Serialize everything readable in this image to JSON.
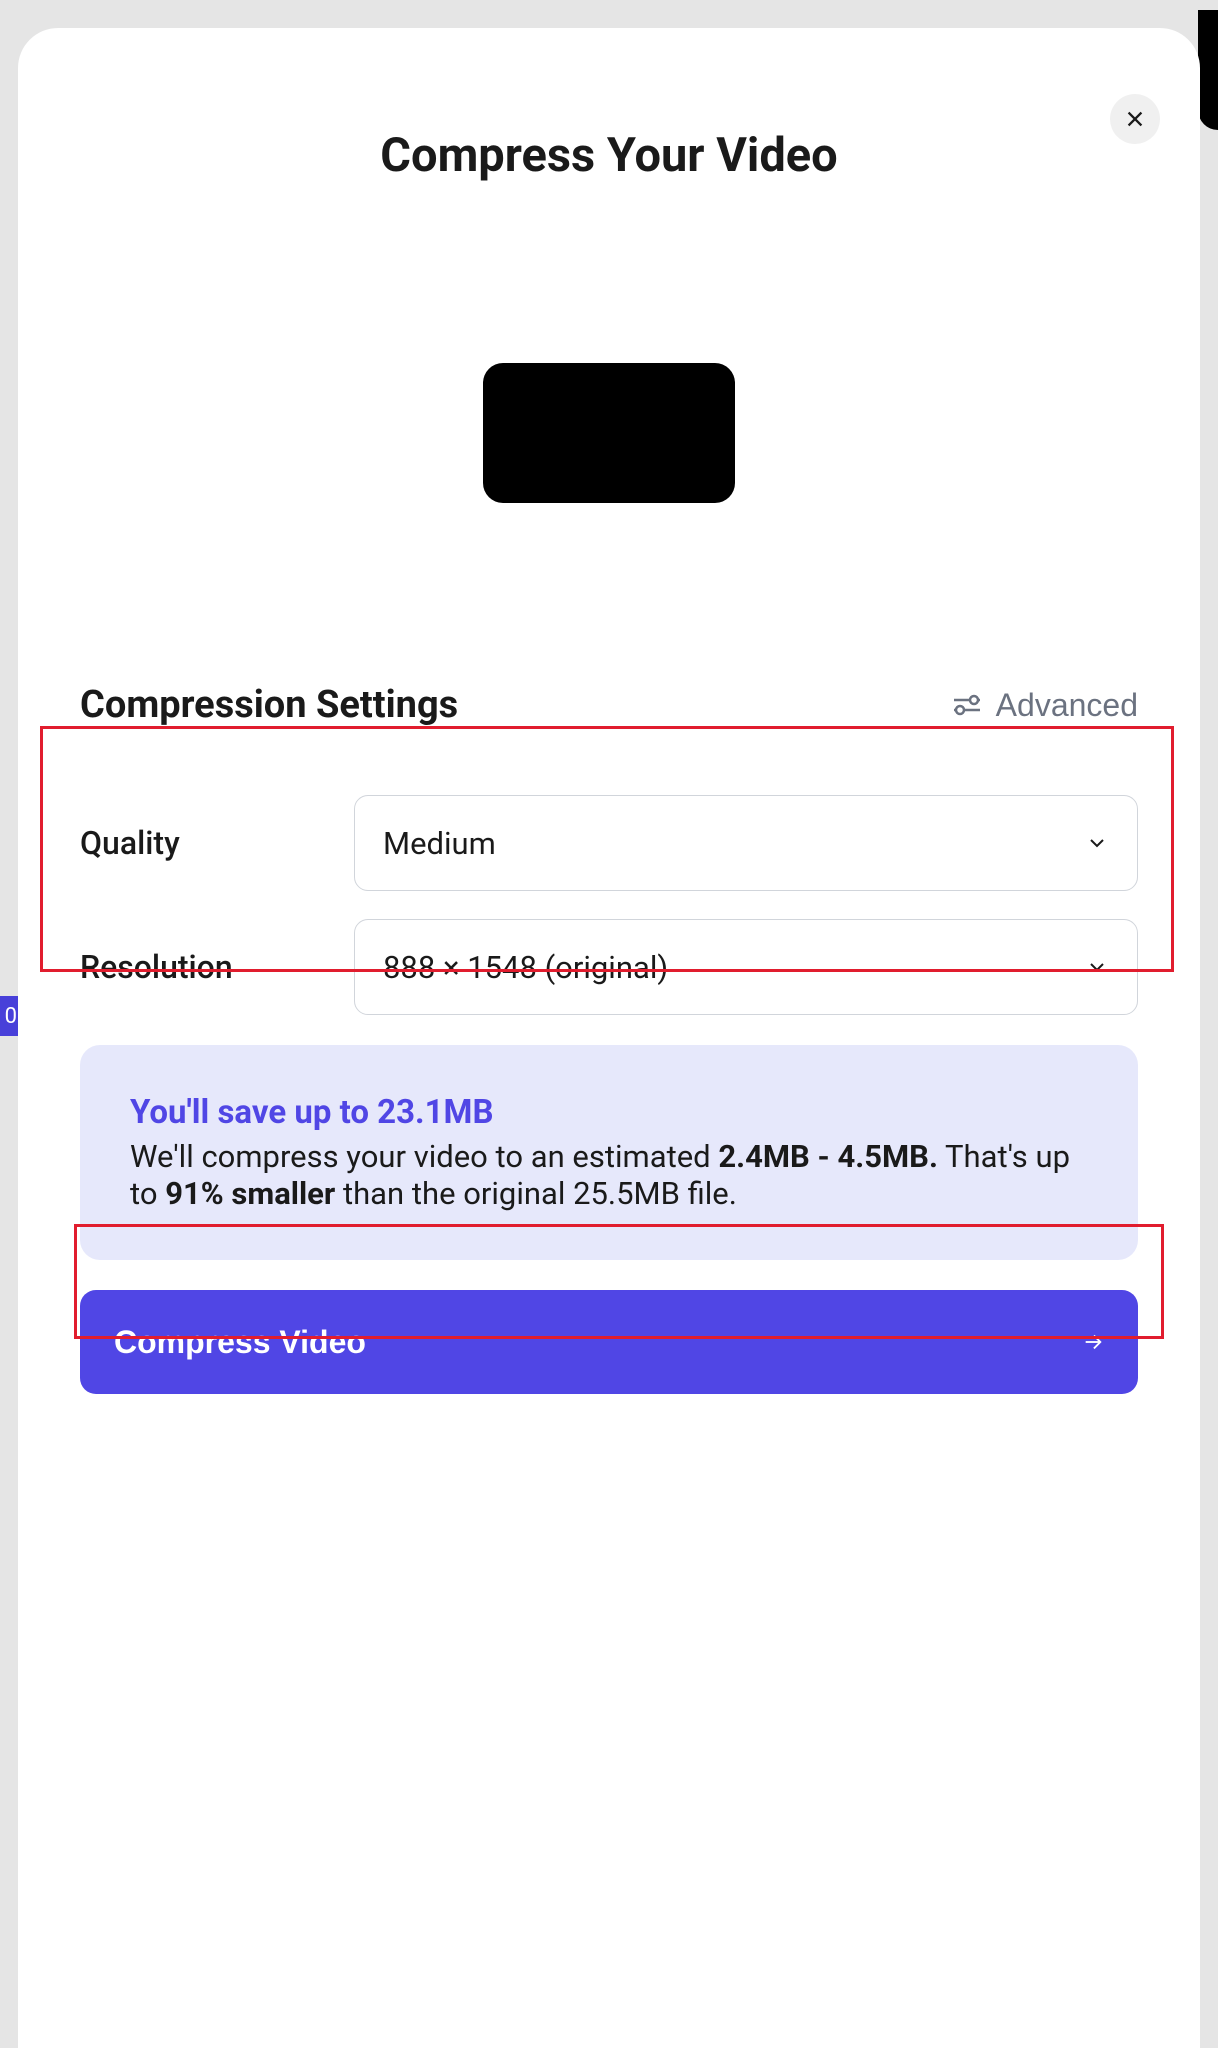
{
  "modal": {
    "title": "Compress Your Video",
    "settings_heading": "Compression Settings",
    "advanced_label": "Advanced",
    "quality_label": "Quality",
    "quality_value": "Medium",
    "resolution_label": "Resolution",
    "resolution_value": "888 × 1548 (original)"
  },
  "info": {
    "title": "You'll save up to 23.1MB",
    "line1_pre": "We'll compress your video to an estimated ",
    "size_range": "2.4MB - 4.5MB.",
    "line2_mid": " That's up to ",
    "percent": "91% smaller",
    "line2_post": " than the original 25.5MB file."
  },
  "cta": {
    "label": "Compress Video"
  },
  "bg": {
    "peek_text": "0"
  }
}
